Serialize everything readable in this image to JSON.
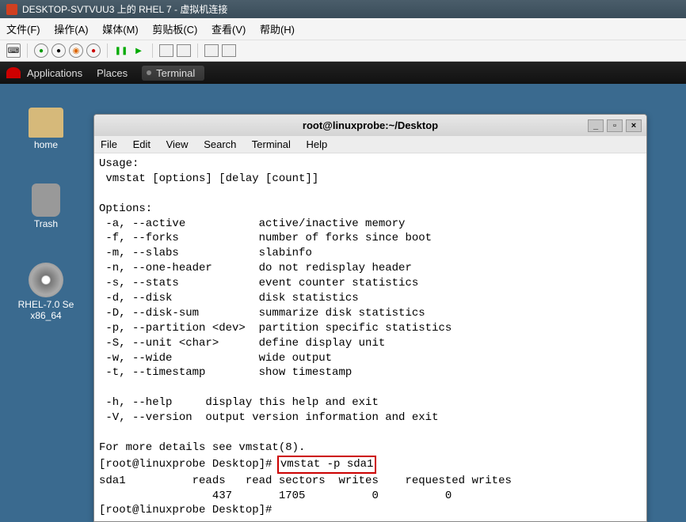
{
  "host_window": {
    "title": "DESKTOP-SVTVUU3 上的 RHEL 7 - 虚拟机连接"
  },
  "host_menubar": {
    "file": "文件(F)",
    "action": "操作(A)",
    "media": "媒体(M)",
    "clipboard": "剪贴板(C)",
    "view": "查看(V)",
    "help": "帮助(H)"
  },
  "gnome": {
    "applications": "Applications",
    "places": "Places",
    "terminal_task": "Terminal"
  },
  "desktop_icons": {
    "home": "home",
    "trash": "Trash",
    "disc_line1": "RHEL-7.0 Se",
    "disc_line2": "x86_64"
  },
  "terminal": {
    "title": "root@linuxprobe:~/Desktop",
    "menu": {
      "file": "File",
      "edit": "Edit",
      "view": "View",
      "search": "Search",
      "terminal": "Terminal",
      "help": "Help"
    },
    "lines": {
      "l01": "Usage:",
      "l02": " vmstat [options] [delay [count]]",
      "l03": "",
      "l04": "Options:",
      "l05": " -a, --active           active/inactive memory",
      "l06": " -f, --forks            number of forks since boot",
      "l07": " -m, --slabs            slabinfo",
      "l08": " -n, --one-header       do not redisplay header",
      "l09": " -s, --stats            event counter statistics",
      "l10": " -d, --disk             disk statistics",
      "l11": " -D, --disk-sum         summarize disk statistics",
      "l12": " -p, --partition <dev>  partition specific statistics",
      "l13": " -S, --unit <char>      define display unit",
      "l14": " -w, --wide             wide output",
      "l15": " -t, --timestamp        show timestamp",
      "l16": "",
      "l17": " -h, --help     display this help and exit",
      "l18": " -V, --version  output version information and exit",
      "l19": "",
      "l20": "For more details see vmstat(8).",
      "prompt1_prefix": "[root@linuxprobe Desktop]# ",
      "prompt1_cmd": "vmstat -p sda1",
      "l22": "sda1          reads   read sectors  writes    requested writes",
      "l23": "                 437       1705          0          0",
      "prompt2_prefix": "[root@linuxprobe Desktop]# "
    }
  }
}
